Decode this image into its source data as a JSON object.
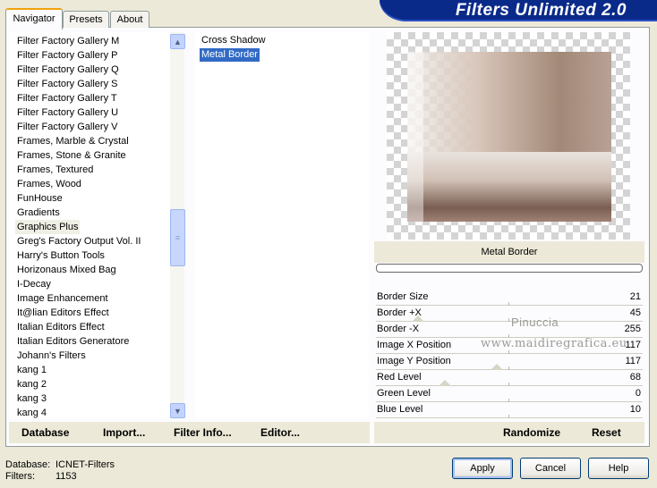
{
  "banner": {
    "title": "Filters Unlimited 2.0"
  },
  "tabs": [
    {
      "label": "Navigator",
      "active": true
    },
    {
      "label": "Presets",
      "active": false
    },
    {
      "label": "About",
      "active": false
    }
  ],
  "categories": [
    "Filter Factory Gallery M",
    "Filter Factory Gallery P",
    "Filter Factory Gallery Q",
    "Filter Factory Gallery S",
    "Filter Factory Gallery T",
    "Filter Factory Gallery U",
    "Filter Factory Gallery V",
    "Frames, Marble & Crystal",
    "Frames, Stone & Granite",
    "Frames, Textured",
    "Frames, Wood",
    "FunHouse",
    "Gradients",
    "Graphics Plus",
    "Greg's Factory Output Vol. II",
    "Harry's Button Tools",
    "Horizonaus Mixed Bag",
    "I-Decay",
    "Image Enhancement",
    "It@lian Editors Effect",
    "Italian Editors Effect",
    "Italian Editors Generatore",
    "Johann's Filters",
    "kang 1",
    "kang 2",
    "kang 3",
    "kang 4"
  ],
  "selected_category": "Graphics Plus",
  "filters": [
    "Cross Shadow",
    "Metal Border"
  ],
  "selected_filter": "Metal Border",
  "filter_name": "Metal Border",
  "parameters": [
    {
      "label": "Border Size",
      "value": "21"
    },
    {
      "label": "Border +X",
      "value": "45"
    },
    {
      "label": "Border -X",
      "value": "255"
    },
    {
      "label": "Image X Position",
      "value": "117"
    },
    {
      "label": "Image Y Position",
      "value": "117"
    },
    {
      "label": "Red Level",
      "value": "68"
    },
    {
      "label": "Green Level",
      "value": "0"
    },
    {
      "label": "Blue Level",
      "value": "10"
    }
  ],
  "watermark": {
    "line1": "Pinuccia",
    "line2": "www.maidiregrafica.eu"
  },
  "left_buttons": {
    "database": "Database",
    "import": "Import...",
    "filter_info": "Filter Info...",
    "editor": "Editor..."
  },
  "right_buttons": {
    "randomize": "Randomize",
    "reset": "Reset"
  },
  "footer": {
    "database_label": "Database:",
    "database_value": "ICNET-Filters",
    "filters_label": "Filters:",
    "filters_value": "1153"
  },
  "dialog_buttons": {
    "apply": "Apply",
    "cancel": "Cancel",
    "help": "Help"
  },
  "icons": {
    "scroll_up": "arrow-up-icon",
    "scroll_down": "arrow-down-icon",
    "scroll_grip": "grip-icon"
  }
}
